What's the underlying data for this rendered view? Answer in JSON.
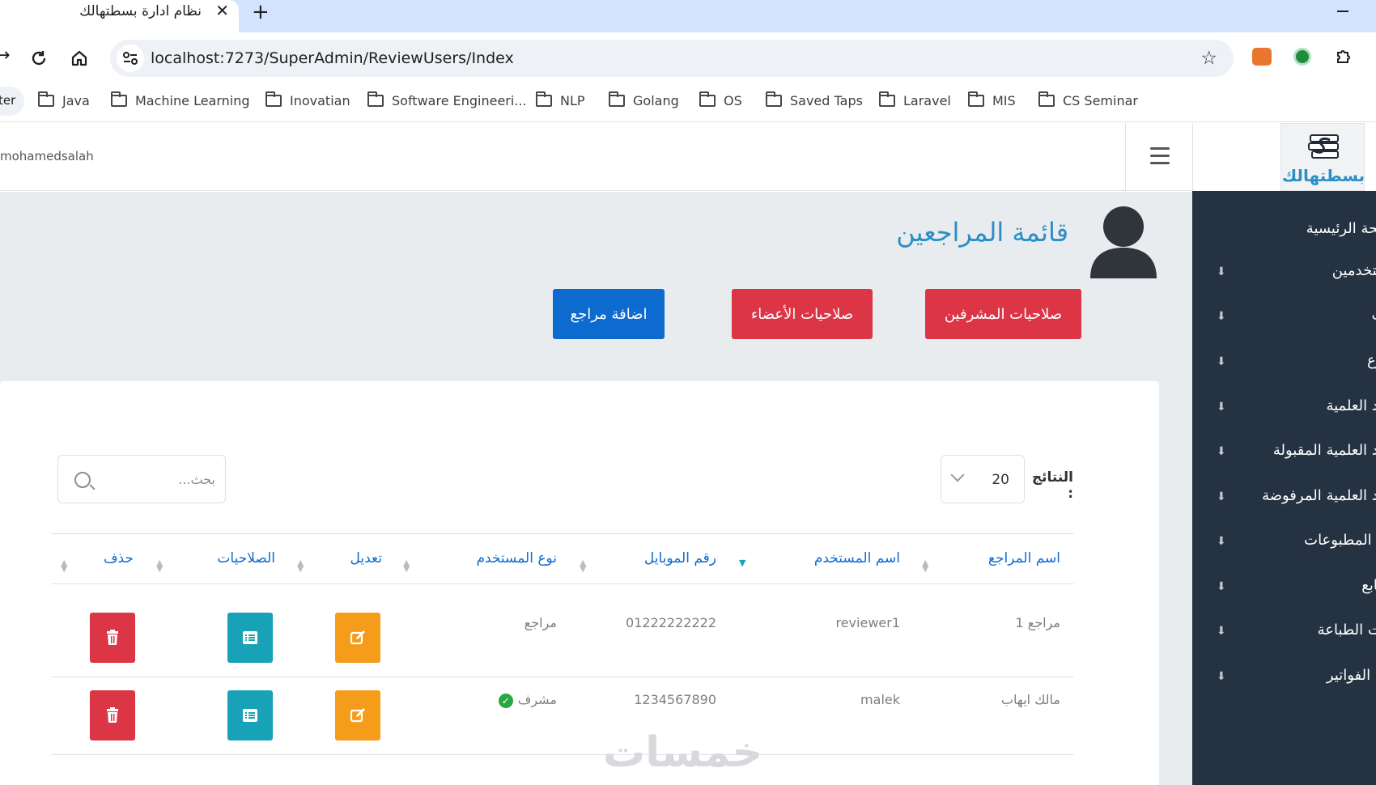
{
  "browser": {
    "tab_title": "نظام ادارة بسطتهالك",
    "url": "localhost:7273/SuperAdmin/ReviewUsers/Index",
    "bookmarks_partial": "ter",
    "bookmarks": [
      "Java",
      "Machine Learning",
      "Inovatian",
      "Software Engineeri...",
      "NLP",
      "Golang",
      "OS",
      "Saved Taps",
      "Laravel",
      "MIS",
      "CS Seminar"
    ]
  },
  "header": {
    "username": "mohamedsalah",
    "logo_text": "بسطتهالك"
  },
  "sidebar": {
    "items": [
      {
        "label": "الصفحة الرئيسية",
        "has_arrow": false
      },
      {
        "label": "المستخدمين",
        "has_arrow": true
      },
      {
        "label": "الكتب",
        "has_arrow": true
      },
      {
        "label": "الفروع",
        "has_arrow": true
      },
      {
        "label": "المواد العلمية",
        "has_arrow": true
      },
      {
        "label": "المواد العلمية المقبولة",
        "has_arrow": true
      },
      {
        "label": "المواد العلمية المرفوضة",
        "has_arrow": true
      },
      {
        "label": "توزيع المطبوعات",
        "has_arrow": true
      },
      {
        "label": "المطابع",
        "has_arrow": true
      },
      {
        "label": "طلبات الطباعة",
        "has_arrow": true
      },
      {
        "label": "قائمة الفواتير",
        "has_arrow": true
      }
    ]
  },
  "page": {
    "title": "قائمة المراجعين",
    "btn_supervisors": "صلاحيات المشرفين",
    "btn_members": "صلاحيات الأعضاء",
    "btn_add": "اضافة مراجع",
    "results_label": "النتائج :",
    "page_size": "20",
    "search_placeholder": "بحث..."
  },
  "table": {
    "headers": [
      "اسم المراجع",
      "اسم المستخدم",
      "رقم الموبايل",
      "نوع المستخدم",
      "تعديل",
      "الصلاحيات",
      "حذف"
    ],
    "rows": [
      {
        "name": "مراجع 1",
        "username": "reviewer1",
        "mobile": "01222222222",
        "type": "مراجع",
        "verified": false
      },
      {
        "name": "مالك ايهاب",
        "username": "malek",
        "mobile": "1234567890",
        "type": "مشرف",
        "verified": true
      }
    ]
  },
  "watermark": "خمسات",
  "colors": {
    "sidebar_bg": "#253241",
    "title_blue": "#2a8fc4",
    "danger": "#dc3545",
    "primary": "#0d6bd0",
    "warning": "#f59c1a",
    "info": "#17a2b8"
  }
}
